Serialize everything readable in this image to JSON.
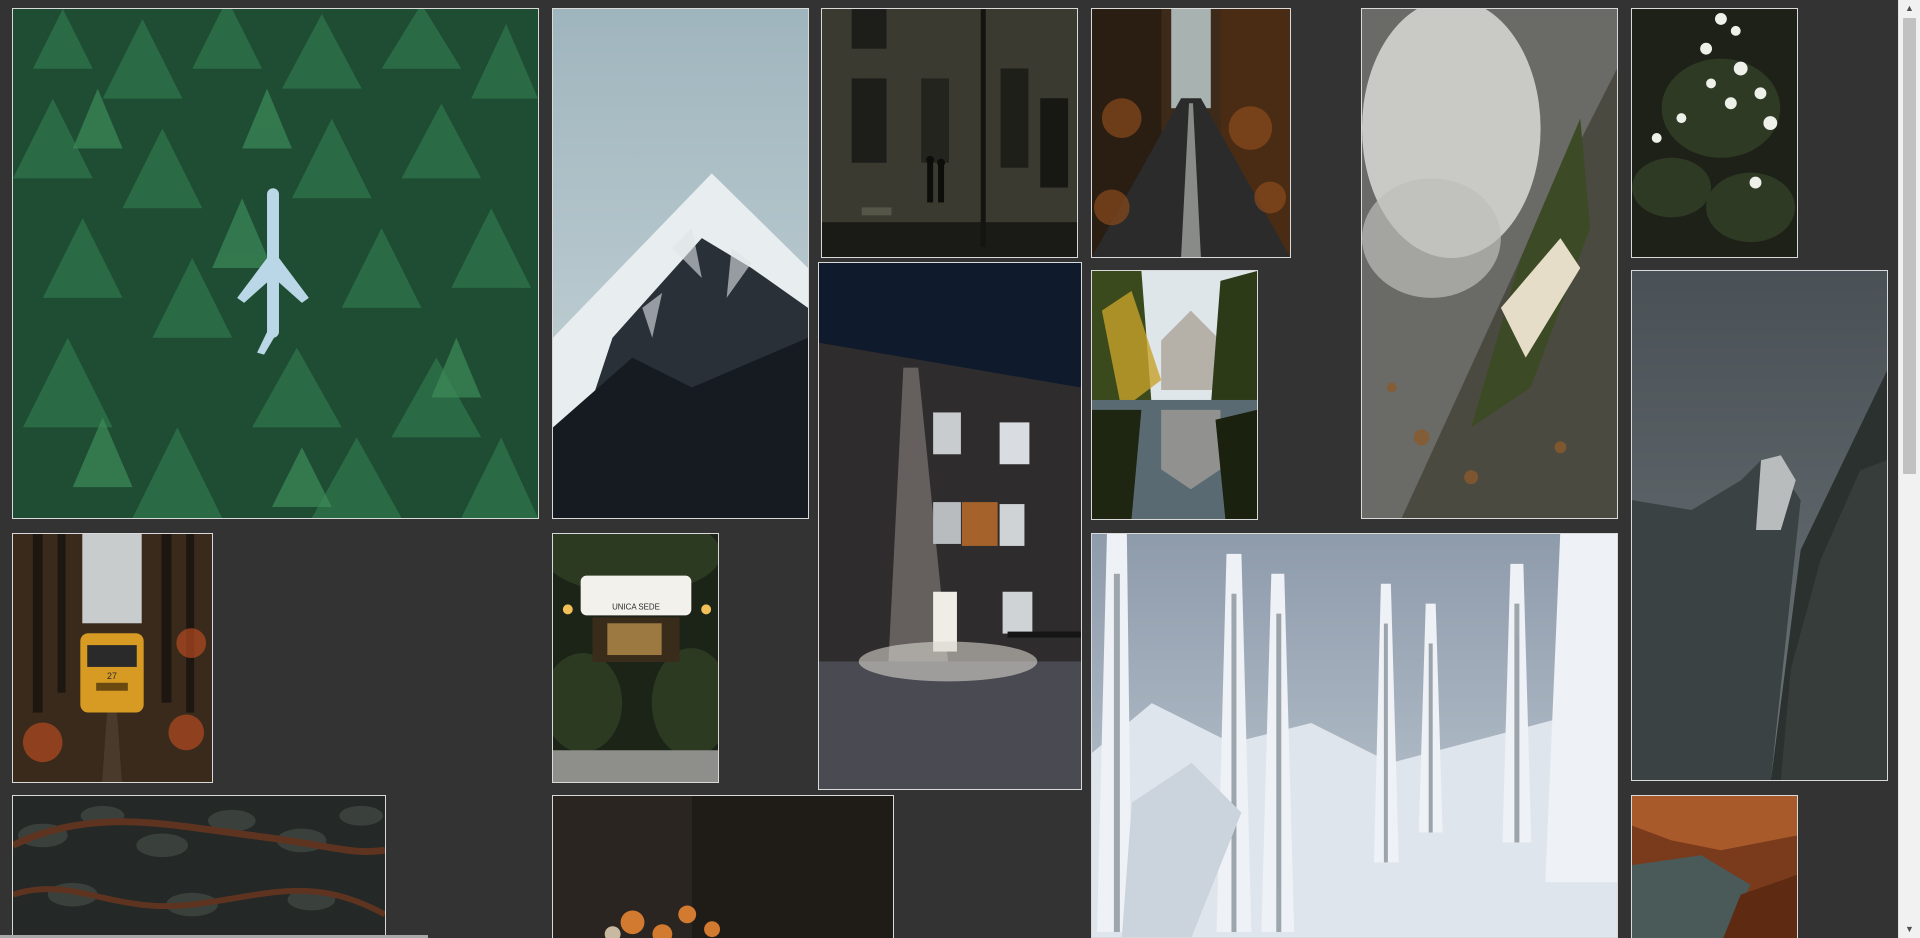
{
  "gallery": {
    "tiles": [
      {
        "name": "photo-forest-airplane",
        "subject": "aerial pine forest with a small airplane"
      },
      {
        "name": "photo-snowy-mountain",
        "subject": "snow-capped mountain peak"
      },
      {
        "name": "photo-street-night",
        "subject": "couple walking on a street at night"
      },
      {
        "name": "photo-autumn-road",
        "subject": "road through autumn forest"
      },
      {
        "name": "photo-mossy-rock",
        "subject": "card on a mossy rock by a waterfall"
      },
      {
        "name": "photo-white-flowers",
        "subject": "white roses on dark foliage"
      },
      {
        "name": "photo-lit-building",
        "subject": "building facade lit at night"
      },
      {
        "name": "photo-yosemite-river",
        "subject": "river reflection with trees and cliff"
      },
      {
        "name": "photo-stormy-cliff",
        "subject": "granite cliff under stormy sky"
      },
      {
        "name": "photo-tram-forest",
        "subject": "yellow tram in autumn forest"
      },
      {
        "name": "photo-storefront",
        "subject": "plant-covered storefront at dusk"
      },
      {
        "name": "photo-snowy-trees",
        "subject": "snow-covered fir trees on a slope"
      },
      {
        "name": "photo-vine-leaves",
        "subject": "dark leaves with twisted vines"
      },
      {
        "name": "photo-orange-flowers",
        "subject": "orange flowers in dim interior"
      },
      {
        "name": "photo-canyon-water",
        "subject": "red canyon walls over water"
      }
    ],
    "storefront_sign": "UNICA SEDE",
    "tram_number": "27"
  },
  "colors": {
    "page_background": "#333333",
    "tile_border": "#d9d9d9",
    "scrollbar_track": "#f1f1f1",
    "scrollbar_thumb": "#c1c1c1"
  },
  "scrollbar": {
    "up_icon": "triangle-up-icon",
    "down_icon": "triangle-down-icon"
  }
}
